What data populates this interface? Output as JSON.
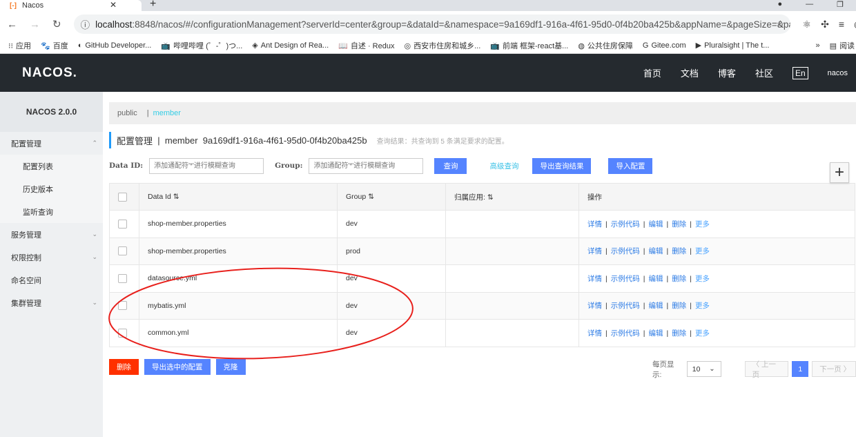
{
  "browser": {
    "tab_title": "Nacos",
    "url_host": "localhost",
    "url_rest": ":8848/nacos/#/configurationManagement?serverId=center&group=&dataId=&namespace=9a169df1-916a-4f61-95d0-0f4b20ba425b&appName=&pageSize=&pag...",
    "bookmarks": [
      "应用",
      "百度",
      "GitHub Developer...",
      "哔哩哔哩 (゜-゜)つ...",
      "Ant Design of Rea...",
      "自述 · Redux",
      "西安市住房和城乡...",
      "前端 框架-react基...",
      "公共住房保障",
      "Gitee.com",
      "Pluralsight | The t..."
    ],
    "bookmarks_more": "»",
    "reading_list": "阅读"
  },
  "header": {
    "logo": "NACOS.",
    "menu": [
      "首页",
      "文档",
      "博客",
      "社区"
    ],
    "lang": "En",
    "user": "nacos"
  },
  "sidebar": {
    "version": "NACOS 2.0.0",
    "items": [
      {
        "label": "配置管理",
        "sub": false,
        "chev": "⌃"
      },
      {
        "label": "配置列表",
        "sub": true
      },
      {
        "label": "历史版本",
        "sub": true
      },
      {
        "label": "监听查询",
        "sub": true
      },
      {
        "label": "服务管理",
        "sub": false,
        "chev": "⌄"
      },
      {
        "label": "权限控制",
        "sub": false,
        "chev": "⌄"
      },
      {
        "label": "命名空间",
        "sub": false
      },
      {
        "label": "集群管理",
        "sub": false,
        "chev": "⌄"
      }
    ]
  },
  "breadcrumb": {
    "public": "public",
    "sep": "|",
    "active": "member"
  },
  "title": {
    "main": "配置管理",
    "sep": "|",
    "ns_name": "member",
    "ns_id": "9a169df1-916a-4f61-95d0-0f4b20ba425b",
    "result": "查询结果：共查询到 5 条满足要求的配置。"
  },
  "filter": {
    "dataid_label": "Data ID:",
    "group_label": "Group:",
    "placeholder": "添加通配符'*'进行模糊查询",
    "query": "查询",
    "advanced": "高级查询",
    "export_results": "导出查询结果",
    "import": "导入配置",
    "add": "+"
  },
  "table": {
    "headers": [
      "Data Id",
      "Group",
      "归属应用:",
      "操作"
    ],
    "rows": [
      {
        "data_id": "shop-member.properties",
        "group": "dev",
        "app": ""
      },
      {
        "data_id": "shop-member.properties",
        "group": "prod",
        "app": ""
      },
      {
        "data_id": "datasource.yml",
        "group": "dev",
        "app": ""
      },
      {
        "data_id": "mybatis.yml",
        "group": "dev",
        "app": ""
      },
      {
        "data_id": "common.yml",
        "group": "dev",
        "app": ""
      }
    ],
    "ops": [
      "详情",
      "示例代码",
      "编辑",
      "删除",
      "更多"
    ]
  },
  "footer": {
    "delete": "删除",
    "export_selected": "导出选中的配置",
    "clone": "克隆",
    "page_size_label": "每页显示:",
    "page_size": "10",
    "prev": "〈 上一页",
    "current_page": "1",
    "next": "下一页 〉"
  },
  "colors": {
    "primary": "#5584ff",
    "danger": "#ff3000",
    "annotation": "#e8201c"
  }
}
